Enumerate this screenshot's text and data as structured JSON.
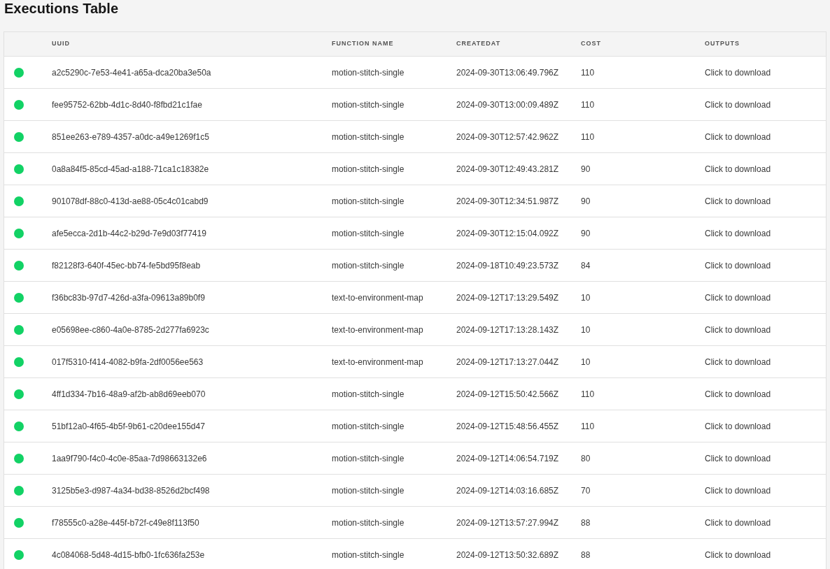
{
  "title": "Executions Table",
  "table": {
    "columns": [
      "UUID",
      "FUNCTION NAME",
      "CREATEDAT",
      "COST",
      "OUTPUTS"
    ],
    "rows": [
      {
        "color": "#12d265",
        "uuid": "a2c5290c-7e53-4e41-a65a-dca20ba3e50a",
        "function_name": "motion-stitch-single",
        "created_at": "2024-09-30T13:06:49.796Z",
        "cost": "110",
        "output": "Click to download"
      },
      {
        "color": "#12d265",
        "uuid": "fee95752-62bb-4d1c-8d40-f8fbd21c1fae",
        "function_name": "motion-stitch-single",
        "created_at": "2024-09-30T13:00:09.489Z",
        "cost": "110",
        "output": "Click to download"
      },
      {
        "color": "#12d265",
        "uuid": "851ee263-e789-4357-a0dc-a49e1269f1c5",
        "function_name": "motion-stitch-single",
        "created_at": "2024-09-30T12:57:42.962Z",
        "cost": "110",
        "output": "Click to download"
      },
      {
        "color": "#12d265",
        "uuid": "0a8a84f5-85cd-45ad-a188-71ca1c18382e",
        "function_name": "motion-stitch-single",
        "created_at": "2024-09-30T12:49:43.281Z",
        "cost": "90",
        "output": "Click to download"
      },
      {
        "color": "#12d265",
        "uuid": "901078df-88c0-413d-ae88-05c4c01cabd9",
        "function_name": "motion-stitch-single",
        "created_at": "2024-09-30T12:34:51.987Z",
        "cost": "90",
        "output": "Click to download"
      },
      {
        "color": "#12d265",
        "uuid": "afe5ecca-2d1b-44c2-b29d-7e9d03f77419",
        "function_name": "motion-stitch-single",
        "created_at": "2024-09-30T12:15:04.092Z",
        "cost": "90",
        "output": "Click to download"
      },
      {
        "color": "#12d265",
        "uuid": "f82128f3-640f-45ec-bb74-fe5bd95f8eab",
        "function_name": "motion-stitch-single",
        "created_at": "2024-09-18T10:49:23.573Z",
        "cost": "84",
        "output": "Click to download"
      },
      {
        "color": "#12d265",
        "uuid": "f36bc83b-97d7-426d-a3fa-09613a89b0f9",
        "function_name": "text-to-environment-map",
        "created_at": "2024-09-12T17:13:29.549Z",
        "cost": "10",
        "output": "Click to download"
      },
      {
        "color": "#12d265",
        "uuid": "e05698ee-c860-4a0e-8785-2d277fa6923c",
        "function_name": "text-to-environment-map",
        "created_at": "2024-09-12T17:13:28.143Z",
        "cost": "10",
        "output": "Click to download"
      },
      {
        "color": "#12d265",
        "uuid": "017f5310-f414-4082-b9fa-2df0056ee563",
        "function_name": "text-to-environment-map",
        "created_at": "2024-09-12T17:13:27.044Z",
        "cost": "10",
        "output": "Click to download"
      },
      {
        "color": "#12d265",
        "uuid": "4ff1d334-7b16-48a9-af2b-ab8d69eeb070",
        "function_name": "motion-stitch-single",
        "created_at": "2024-09-12T15:50:42.566Z",
        "cost": "110",
        "output": "Click to download"
      },
      {
        "color": "#12d265",
        "uuid": "51bf12a0-4f65-4b5f-9b61-c20dee155d47",
        "function_name": "motion-stitch-single",
        "created_at": "2024-09-12T15:48:56.455Z",
        "cost": "110",
        "output": "Click to download"
      },
      {
        "color": "#12d265",
        "uuid": "1aa9f790-f4c0-4c0e-85aa-7d98663132e6",
        "function_name": "motion-stitch-single",
        "created_at": "2024-09-12T14:06:54.719Z",
        "cost": "80",
        "output": "Click to download"
      },
      {
        "color": "#12d265",
        "uuid": "3125b5e3-d987-4a34-bd38-8526d2bcf498",
        "function_name": "motion-stitch-single",
        "created_at": "2024-09-12T14:03:16.685Z",
        "cost": "70",
        "output": "Click to download"
      },
      {
        "color": "#12d265",
        "uuid": "f78555c0-a28e-445f-b72f-c49e8f113f50",
        "function_name": "motion-stitch-single",
        "created_at": "2024-09-12T13:57:27.994Z",
        "cost": "88",
        "output": "Click to download"
      },
      {
        "color": "#12d265",
        "uuid": "4c084068-5d48-4d15-bfb0-1fc636fa253e",
        "function_name": "motion-stitch-single",
        "created_at": "2024-09-12T13:50:32.689Z",
        "cost": "88",
        "output": "Click to download"
      }
    ]
  }
}
